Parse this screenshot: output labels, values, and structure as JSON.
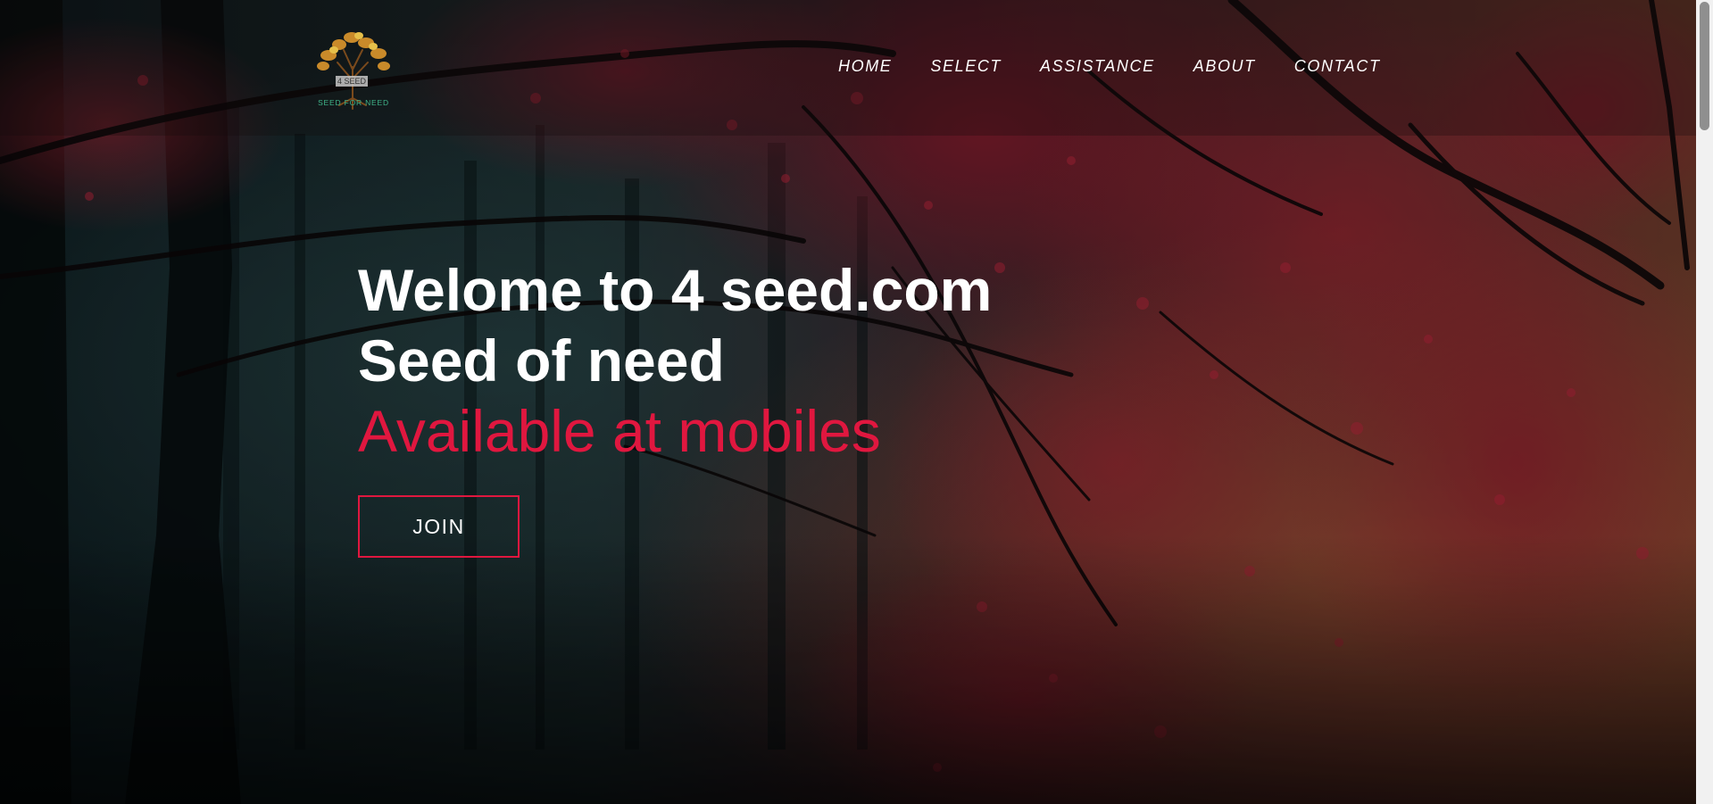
{
  "logo": {
    "badge": "4 SEED",
    "tagline": "SEED FOR NEED"
  },
  "nav": {
    "items": [
      "HOME",
      "SELECT",
      "ASSISTANCE",
      "ABOUT",
      "CONTACT"
    ]
  },
  "hero": {
    "line1": "Welome to 4 seed.com",
    "line2": "Seed of need",
    "line3": "Available at mobiles",
    "join_label": "JOIN"
  },
  "colors": {
    "accent": "#e0173f",
    "text": "#ffffff",
    "logo_tagline": "#3fb58a"
  }
}
